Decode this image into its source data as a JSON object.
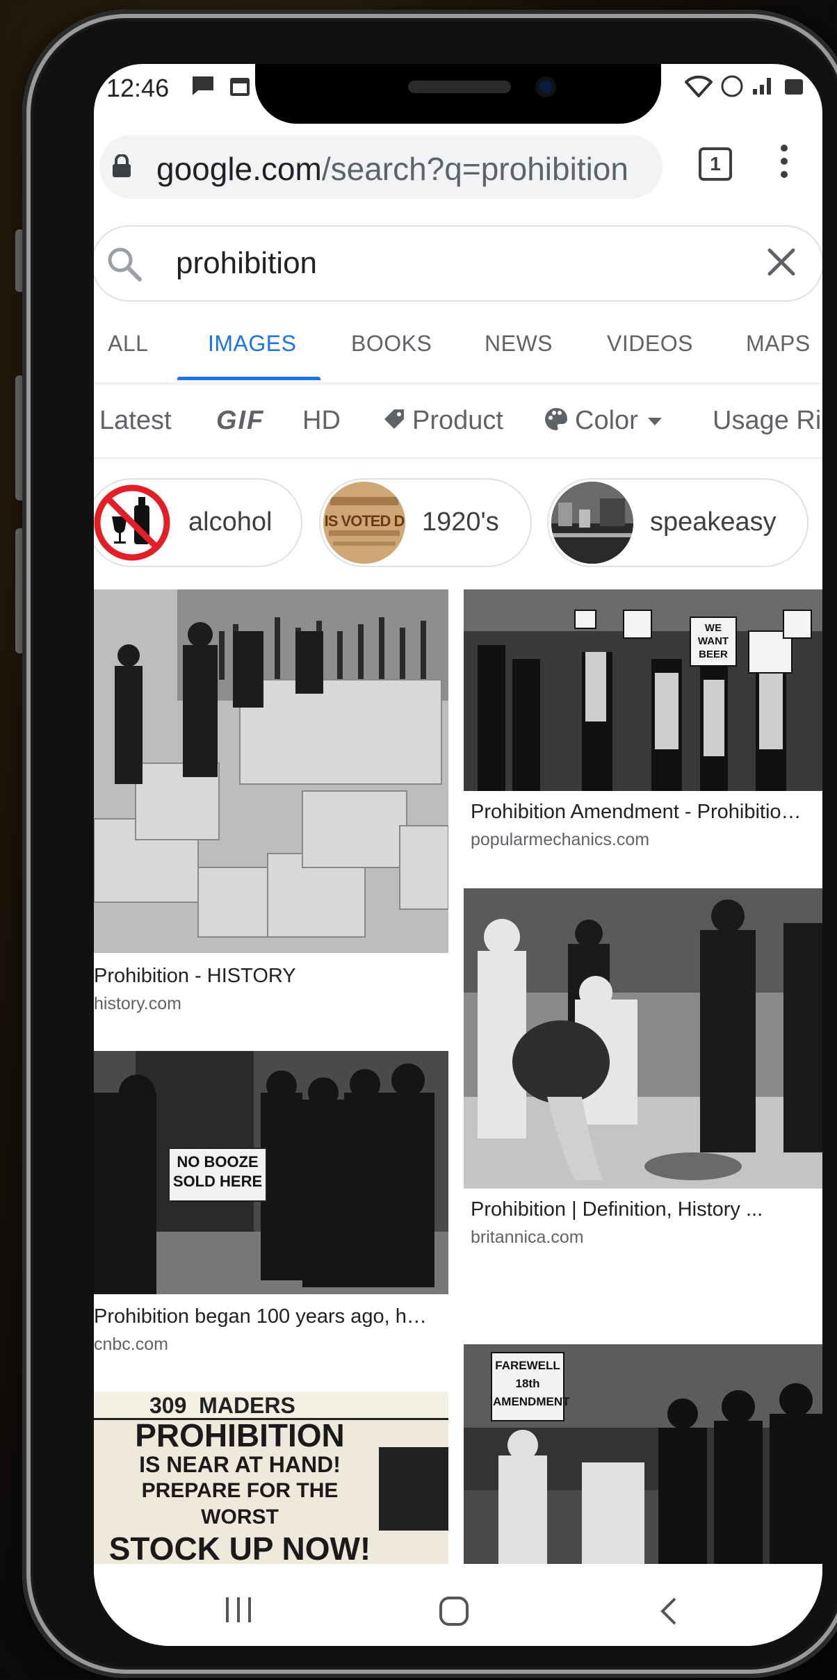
{
  "status": {
    "time": "12:46",
    "tab_count": "1"
  },
  "url": {
    "domain": "google.com",
    "path": "/search?q=prohibition"
  },
  "search": {
    "query": "prohibition"
  },
  "tabs": [
    "ALL",
    "IMAGES",
    "BOOKS",
    "NEWS",
    "VIDEOS",
    "MAPS"
  ],
  "filters": {
    "latest": "Latest",
    "gif": "GIF",
    "hd": "HD",
    "product": "Product",
    "color": "Color",
    "usage": "Usage Ri"
  },
  "chips": [
    "alcohol",
    "1920's",
    "speakeasy"
  ],
  "results": [
    {
      "title": "Prohibition - HISTORY",
      "source": "history.com"
    },
    {
      "title": "Prohibition Amendment - Prohibitio…",
      "source": "popularmechanics.com"
    },
    {
      "title": "Prohibition began 100 years ago, h…",
      "source": "cnbc.com"
    },
    {
      "title": "Prohibition | Definition, History ...",
      "source": "britannica.com"
    }
  ],
  "image_text": {
    "sign_no_booze": "NO BOOZE SOLD HERE",
    "sign_we_want_beer": "WE WANT BEER",
    "sign_farewell": "FAREWELL 18th AMENDMENT",
    "poster_line1": "PROHIBITION",
    "poster_line2": "IS NEAR AT HAND!",
    "poster_line3": "PREPARE FOR THE WORST",
    "poster_line4": "STOCK UP NOW!",
    "poster_top": "309  MADERS",
    "chip_newspaper": "IS VOTED D"
  },
  "colors": {
    "accent": "#1a73e8",
    "text": "#202124",
    "muted": "#5f6368"
  }
}
